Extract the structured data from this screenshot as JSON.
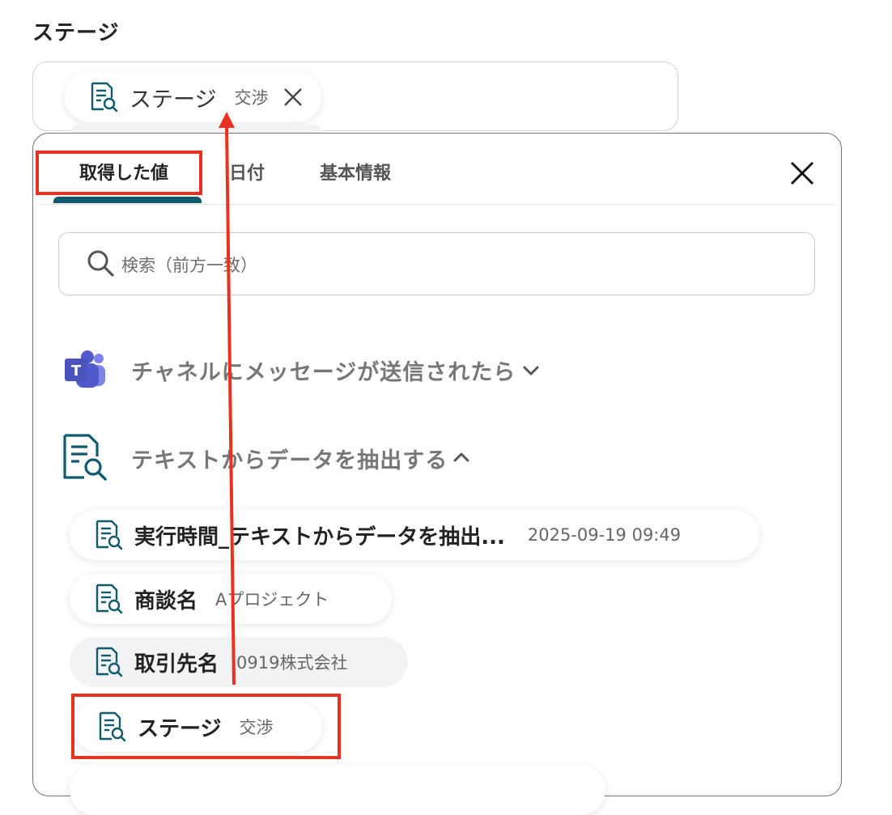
{
  "field": {
    "label": "ステージ"
  },
  "selected_chip": {
    "name": "ステージ",
    "value": "交渉",
    "icon": "document-search-icon",
    "remove_icon": "close-icon"
  },
  "panel": {
    "tabs": [
      {
        "label": "取得した値",
        "active": true
      },
      {
        "label": "日付",
        "active": false
      },
      {
        "label": "基本情報",
        "active": false
      }
    ],
    "close_icon": "close-icon",
    "search": {
      "placeholder": "検索（前方一致）",
      "icon": "search-icon"
    },
    "groups": [
      {
        "title": "チャネルにメッセージが送信されたら",
        "icon": "teams-icon",
        "expanded": false,
        "chevron": "chevron-down-icon"
      },
      {
        "title": "テキストからデータを抽出する",
        "icon": "document-search-icon",
        "expanded": true,
        "chevron": "chevron-up-icon"
      }
    ],
    "items": [
      {
        "name": "実行時間_テキストからデータを抽出...",
        "value": "2025-09-19 09:49"
      },
      {
        "name": "商談名",
        "value": "Aプロジェクト"
      },
      {
        "name": "取引先名",
        "value": "0919株式会社"
      },
      {
        "name": "ステージ",
        "value": "交渉"
      }
    ]
  },
  "colors": {
    "accent": "#105a6e",
    "highlight": "#e8321f",
    "teams": "#5059c9"
  }
}
